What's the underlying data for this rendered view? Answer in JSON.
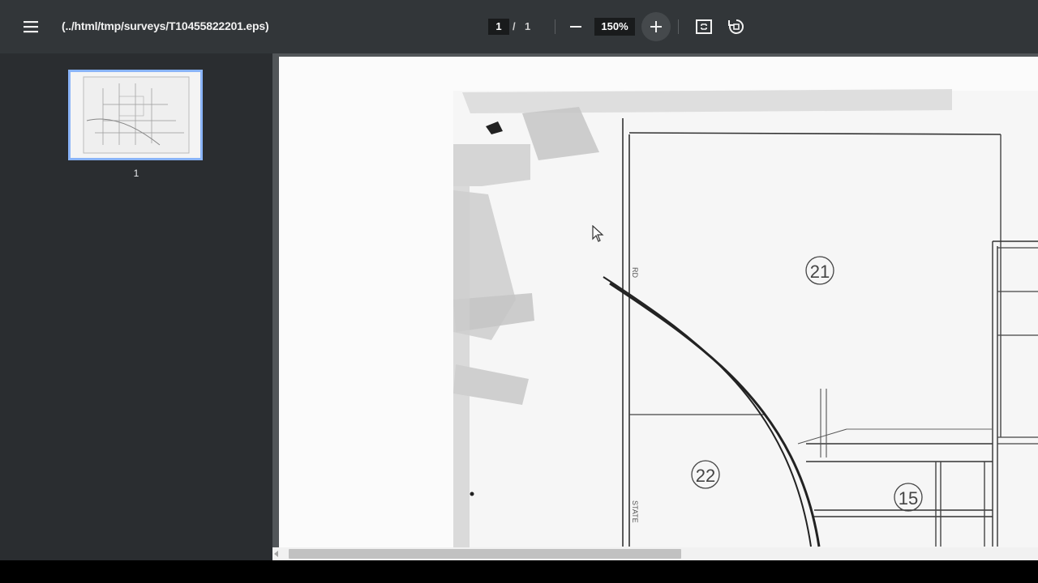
{
  "toolbar": {
    "file_path": "(../html/tmp/surveys/T10455822201.eps)",
    "current_page": "1",
    "page_separator": "/",
    "total_pages": "1",
    "zoom": "150%"
  },
  "sidebar": {
    "thumbnails": [
      {
        "page_number": "1"
      }
    ]
  },
  "map": {
    "section_labels": [
      "21",
      "22",
      "15"
    ],
    "road_label_1": "RD",
    "road_label_2": "STATE"
  },
  "colors": {
    "toolbar_bg": "#323639",
    "sidebar_bg": "#2a2d30",
    "thumb_border": "#8ab4f8"
  }
}
